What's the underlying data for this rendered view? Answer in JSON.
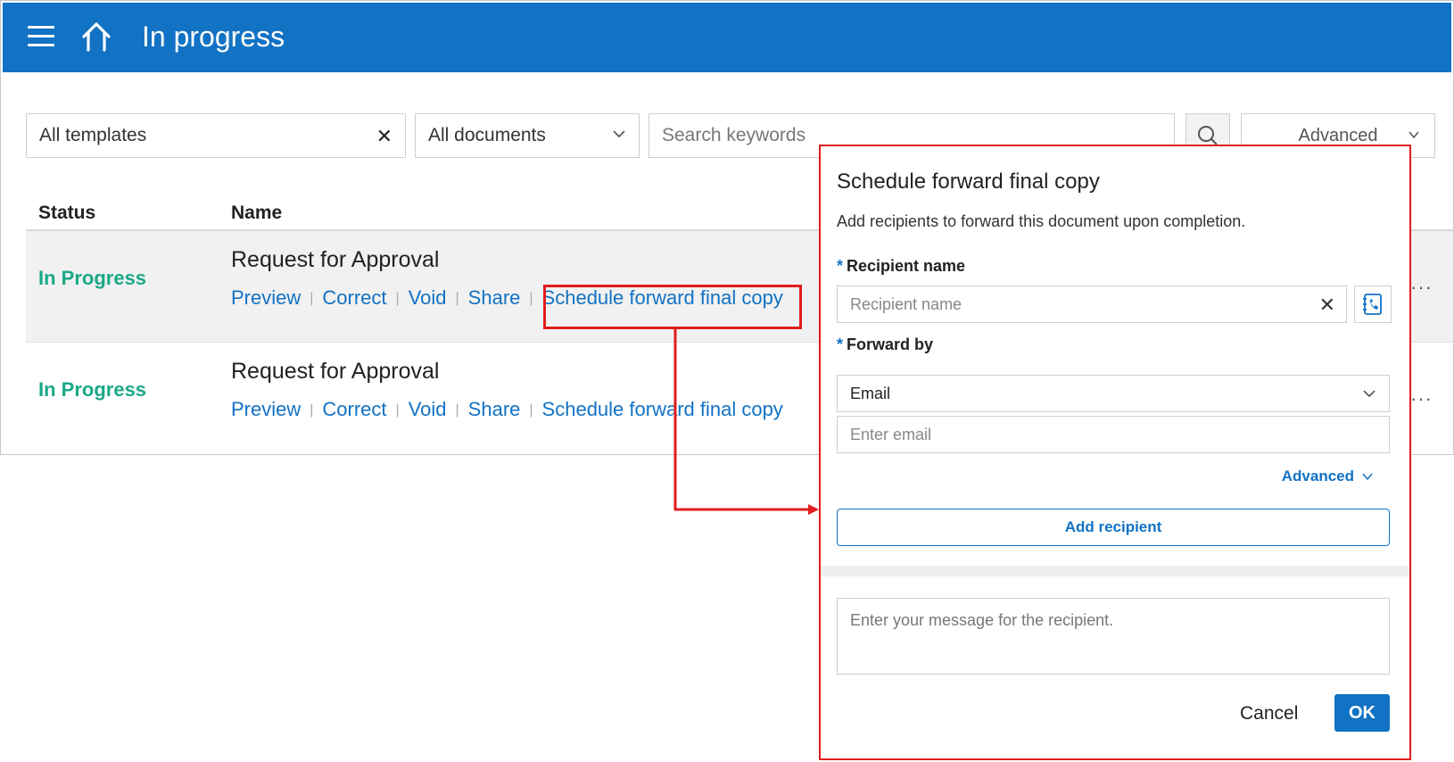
{
  "header": {
    "title": "In progress",
    "menu_icon": "hamburger-menu-icon",
    "home_icon": "home-icon",
    "bg_color": "#1272c4"
  },
  "filters": {
    "template_value": "All templates",
    "documents_value": "All documents",
    "search_placeholder": "Search keywords",
    "advanced_label": "Advanced"
  },
  "table": {
    "columns": [
      "Status",
      "Name"
    ],
    "rows": [
      {
        "status": "In Progress",
        "name": "Request for Approval",
        "actions": [
          "Preview",
          "Correct",
          "Void",
          "Share",
          "Schedule forward final copy"
        ],
        "more": "···"
      },
      {
        "status": "In Progress",
        "name": "Request for Approval",
        "actions": [
          "Preview",
          "Correct",
          "Void",
          "Share",
          "Schedule forward final copy"
        ],
        "more": "···"
      }
    ]
  },
  "dialog": {
    "title": "Schedule forward final copy",
    "subtitle": "Add recipients to forward this document upon completion.",
    "recipient_label": "Recipient name",
    "recipient_placeholder": "Recipient name",
    "forward_label": "Forward by",
    "forward_value": "Email",
    "email_placeholder": "Enter email",
    "advanced_label": "Advanced",
    "add_button": "Add recipient",
    "message_placeholder": "Enter your message for the recipient.",
    "cancel_button": "Cancel",
    "ok_button": "OK"
  },
  "colors": {
    "accent": "#1272c4",
    "status_green": "#1aa888",
    "annotation_red": "#e11d1d"
  }
}
